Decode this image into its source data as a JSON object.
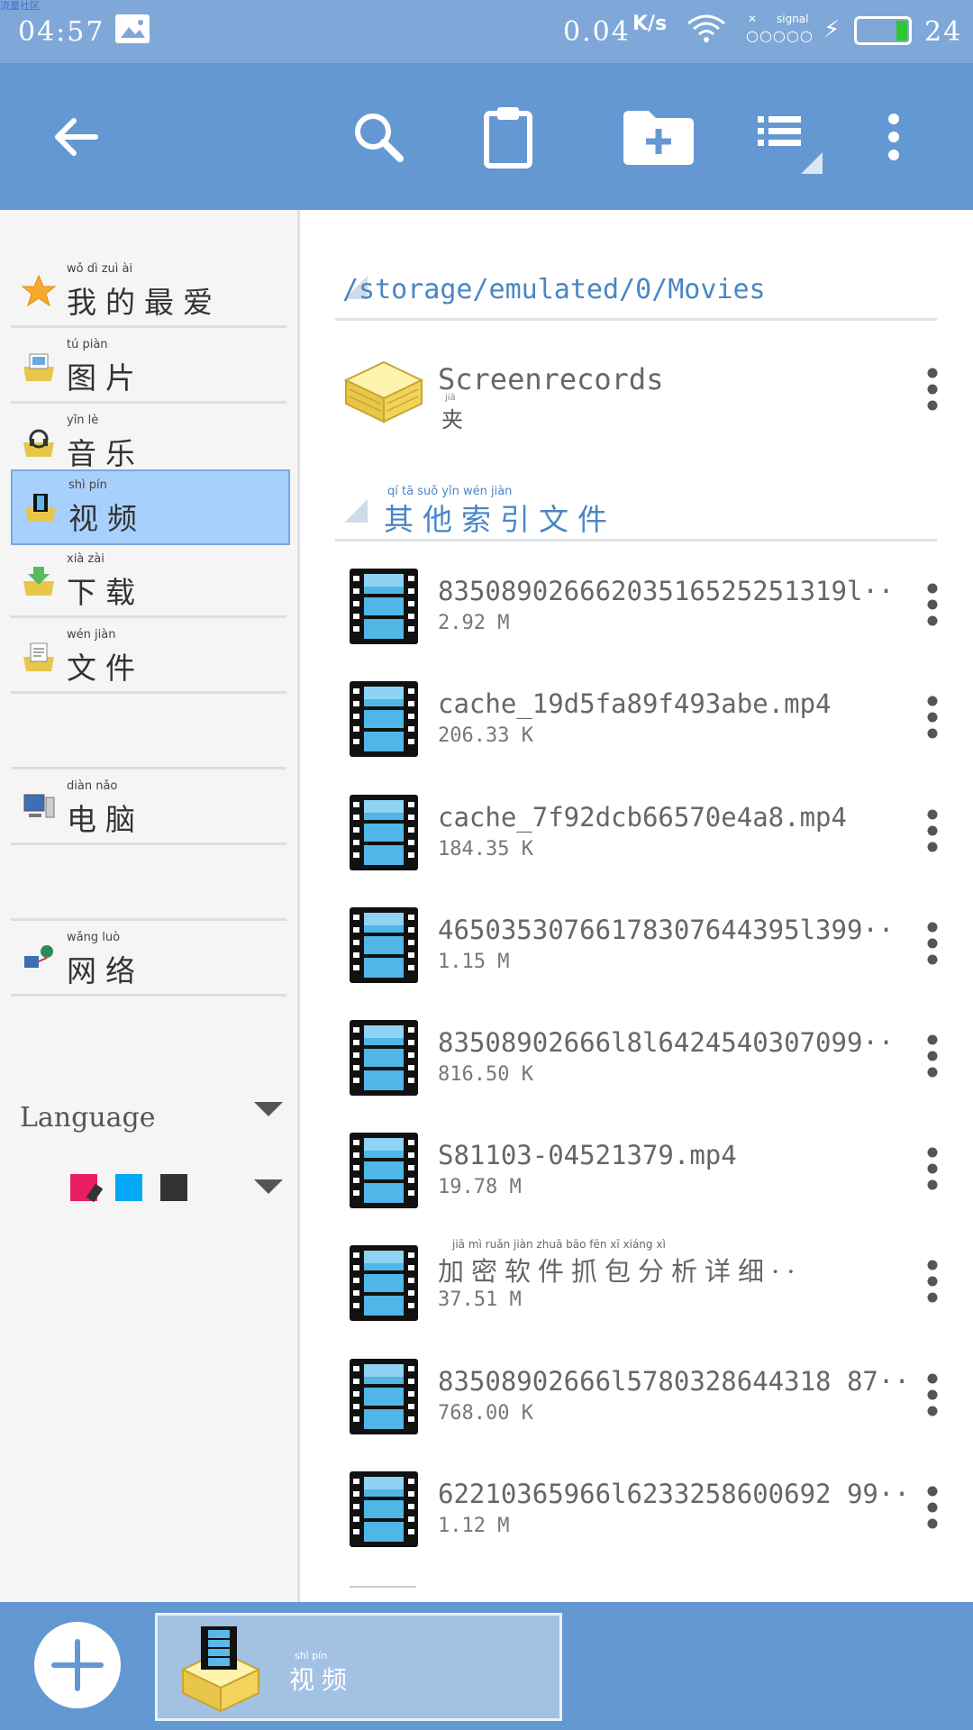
{
  "status_bar": {
    "watermark": "流量社区",
    "time": "04:57",
    "speed_value": "0.04",
    "speed_unit": "K/s",
    "signal_label": "signal",
    "battery": "24"
  },
  "toolbar": {
    "back": "back-arrow-icon",
    "search": "search-icon",
    "clipboard": "clipboard-icon",
    "new_folder": "new-folder-icon",
    "list_view": "list-view-icon",
    "menu": "more-vert-icon"
  },
  "sidebar": {
    "items": [
      {
        "pinyin": "wǒ  dì  zuì  ài",
        "label": "我的最爱",
        "icon": "star-icon"
      },
      {
        "pinyin": "tú  piàn",
        "label": "图片",
        "icon": "picture-folder-icon"
      },
      {
        "pinyin": "yīn  lè",
        "label": "音乐",
        "icon": "music-folder-icon"
      },
      {
        "pinyin": "shì  pín",
        "label": "视频",
        "icon": "video-folder-icon"
      },
      {
        "pinyin": "xià  zài",
        "label": "下载",
        "icon": "download-folder-icon"
      },
      {
        "pinyin": "wén  jiàn",
        "label": "文件",
        "icon": "document-folder-icon"
      },
      {
        "pinyin": "diàn  nǎo",
        "label": "电脑",
        "icon": "computer-icon"
      },
      {
        "pinyin": "wǎng  luò",
        "label": "网络",
        "icon": "network-icon"
      }
    ],
    "language_label": "Language",
    "theme_colors": [
      "#e91e63",
      "#03a9f4",
      "#333333"
    ]
  },
  "content": {
    "path": "/storage/emulated/0/Movies",
    "folder": {
      "name": "Screenrecords",
      "sub_pinyin": "jiā",
      "sub": "夹"
    },
    "section_pinyin": "qí  tā  suǒ  yǐn  wén  jiàn",
    "section_title": "其他索引文件",
    "files": [
      {
        "name": "83508902666203516525251319l··",
        "size": "2.92 M"
      },
      {
        "name": "cache_19d5fa89f493abe.mp4",
        "size": "206.33 K"
      },
      {
        "name": "cache_7f92dcb66570e4a8.mp4",
        "size": "184.35 K"
      },
      {
        "name": "46503530766178307644395l399··",
        "size": "1.15 M"
      },
      {
        "name": "83508902666l8l6424540307099··",
        "size": "816.50 K"
      },
      {
        "name": "S81103-04521379.mp4",
        "size": "19.78 M"
      },
      {
        "name": "加密软件抓包分析详细··",
        "pinyin": "jiā  mì  ruǎn  jiàn  zhuā  bāo  fēn  xī  xiáng  xì",
        "size": "37.51 M"
      },
      {
        "name": "83508902666l5780328644318 87··",
        "size": "768.00 K"
      },
      {
        "name": "62210365966l6233258600692 99··",
        "size": "1.12 M"
      }
    ]
  },
  "bottom_bar": {
    "add": "add-icon",
    "tab_pinyin": "shì  pín",
    "tab_label": "视频"
  }
}
